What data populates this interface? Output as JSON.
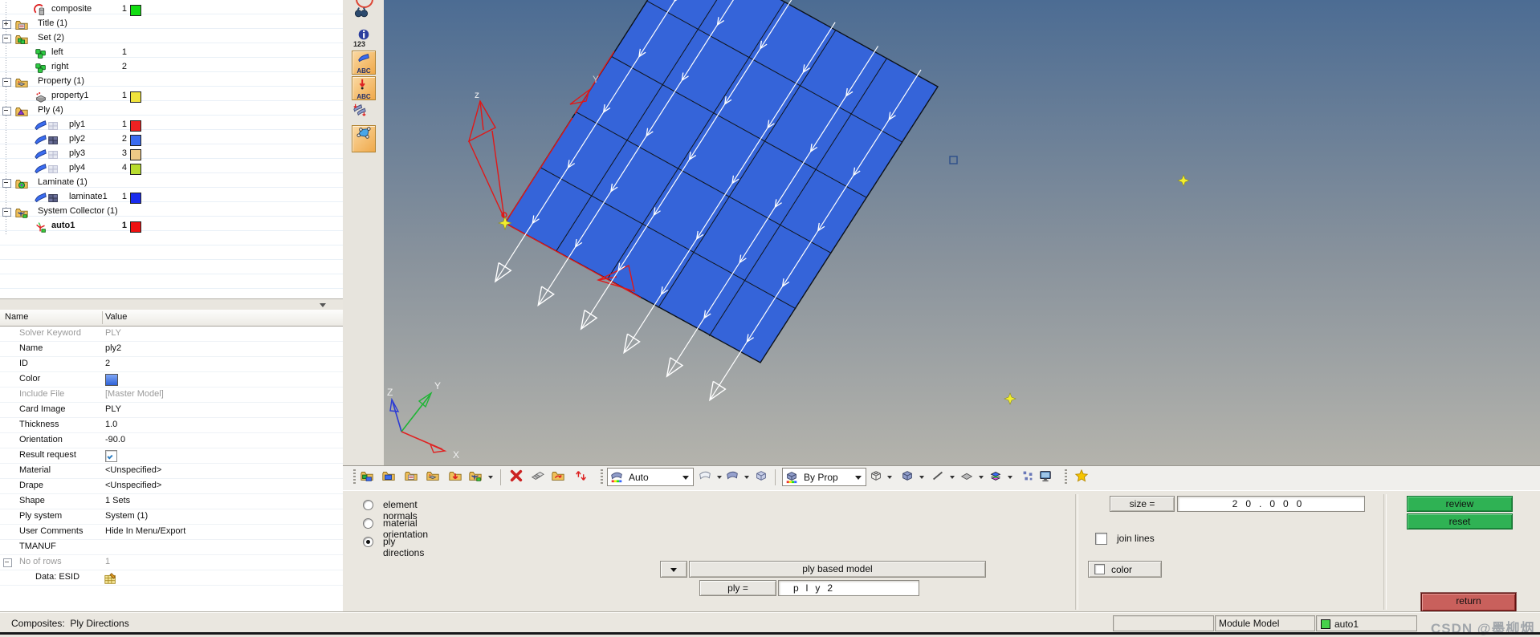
{
  "tree": {
    "items": [
      {
        "label": "composite",
        "id": "1",
        "swatch": "#12dd12"
      },
      {
        "label": "Title (1)",
        "id": ""
      },
      {
        "label": "Set (2)",
        "id": ""
      },
      {
        "label": "left",
        "id": "1"
      },
      {
        "label": "right",
        "id": "2"
      },
      {
        "label": "Property (1)",
        "id": ""
      },
      {
        "label": "property1",
        "id": "1",
        "swatch": "#f0e33c"
      },
      {
        "label": "Ply (4)",
        "id": ""
      },
      {
        "label": "ply1",
        "id": "1",
        "swatch": "#ee2222"
      },
      {
        "label": "ply2",
        "id": "2",
        "swatch": "#3a6cf0"
      },
      {
        "label": "ply3",
        "id": "3",
        "swatch": "#eeca86"
      },
      {
        "label": "ply4",
        "id": "4",
        "swatch": "#b8dc30"
      },
      {
        "label": "Laminate (1)",
        "id": ""
      },
      {
        "label": "laminate1",
        "id": "1",
        "swatch": "#1a2cee"
      },
      {
        "label": "System Collector (1)",
        "id": ""
      },
      {
        "label": "auto1",
        "id": "1",
        "swatch": "#ee1111"
      }
    ]
  },
  "properties": {
    "columns": {
      "name": "Name",
      "value": "Value"
    },
    "rows": [
      {
        "name": "Solver Keyword",
        "value": "PLY"
      },
      {
        "name": "Name",
        "value": "ply2"
      },
      {
        "name": "ID",
        "value": "2"
      },
      {
        "name": "Color",
        "value": "",
        "color_swatch": "#3e6fe0"
      },
      {
        "name": "Include File",
        "value": "[Master Model]"
      },
      {
        "name": "Card Image",
        "value": "PLY"
      },
      {
        "name": "Thickness",
        "value": "1.0"
      },
      {
        "name": "Orientation",
        "value": "-90.0"
      },
      {
        "name": "Result request",
        "value": ""
      },
      {
        "name": "Material",
        "value": "<Unspecified>"
      },
      {
        "name": "Drape",
        "value": "<Unspecified>"
      },
      {
        "name": "Shape",
        "value": "1 Sets"
      },
      {
        "name": "Ply system",
        "value": "System (1)"
      },
      {
        "name": "User Comments",
        "value": "Hide In Menu/Export"
      },
      {
        "name": "TMANUF",
        "value": ""
      },
      {
        "name": "No of rows",
        "value": "1"
      },
      {
        "name": "Data: ESID",
        "value": ""
      }
    ]
  },
  "side_toolbar": {
    "counter_label": "123",
    "abc1_label": "ABC",
    "abc2_label": "ABC"
  },
  "toolbar": {
    "auto_mode": "Auto",
    "color_mode": "By Prop"
  },
  "viewport": {
    "triad_z": "z",
    "edge_y": "Y",
    "axis_x": "X",
    "axis_y": "Y",
    "axis_z": "Z"
  },
  "panel": {
    "radio_options": [
      "element normals",
      "material orientation",
      "ply directions"
    ],
    "selected_radio": "ply directions",
    "size_label": "size =",
    "size_value": "20.000",
    "review_label": "review",
    "reset_label": "reset",
    "join_lines_label": "join lines",
    "model_type_label": "ply based model",
    "color_label": "color",
    "ply_label": "ply =",
    "ply_value": "ply2",
    "return_label": "return"
  },
  "status": {
    "mode": "Composites:  Ply Directions",
    "module": "Module Model",
    "current_collector": "auto1",
    "collector_swatch": "#46d24a",
    "watermark": "CSDN @墨柳烟"
  },
  "colors": {
    "plate": "#3564d9",
    "viewport_top": "#4c6c93",
    "viewport_bottom": "#b4b3ac",
    "review_green": "#2fb254",
    "return_red": "#c9605c",
    "selection_blue": "#b9d5ea"
  }
}
